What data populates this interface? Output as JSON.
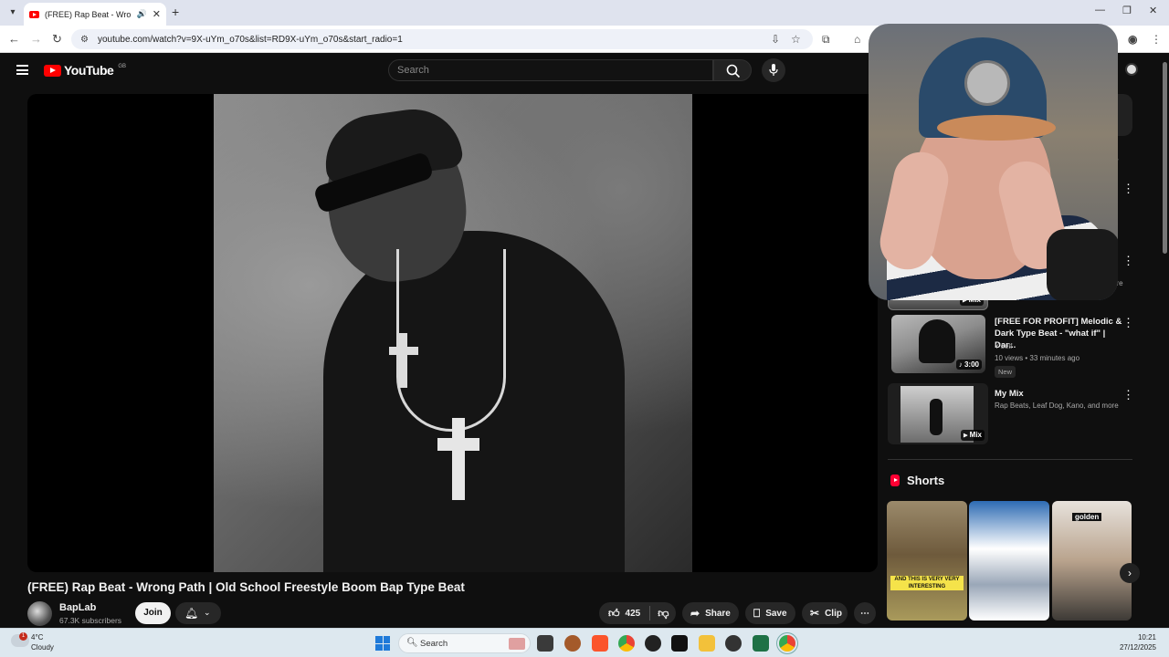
{
  "browser": {
    "tab_title": "(FREE) Rap Beat - Wrong Path",
    "url": "youtube.com/watch?v=9X-uYm_o70s&list=RD9X-uYm_o70s&start_radio=1"
  },
  "youtube": {
    "logo_text": "YouTube",
    "region": "GB",
    "search_placeholder": "Search"
  },
  "video": {
    "title": "(FREE) Rap Beat - Wrong Path | Old School Freestyle Boom Bap Type Beat",
    "channel_name": "BapLab",
    "subscribers": "67.3K subscribers",
    "join_label": "Join",
    "likes": "425",
    "share_label": "Share",
    "save_label": "Save",
    "clip_label": "Clip"
  },
  "sidebar": {
    "more_label": "ore",
    "items": [
      {
        "badge": "Mix"
      },
      {
        "title": "[FREE FOR PROFIT] Melodic & Dark Type Beat - \"what if\" | Dar...",
        "channel": "Y'self",
        "meta": "10 views • 33 minutes ago",
        "tag": "New",
        "duration": "3:00"
      },
      {
        "title": "My Mix",
        "channel": "Rap Beats, Leaf Dog, Kano, and more",
        "badge": "Mix"
      }
    ],
    "shorts_title": "Shorts",
    "shorts": [
      {
        "caption": "AND THIS IS VERY VERY INTERESTING"
      },
      {
        "caption": ""
      },
      {
        "caption": "golden"
      }
    ]
  },
  "taskbar": {
    "temperature": "4°C",
    "condition": "Cloudy",
    "weather_badge": "1",
    "search_label": "Search",
    "time": "10:21",
    "date": "27/12/2025"
  },
  "colors": {
    "youtube_red": "#ff0000",
    "shorts_red": "#ff0033",
    "page_bg": "#0f0f0f"
  }
}
